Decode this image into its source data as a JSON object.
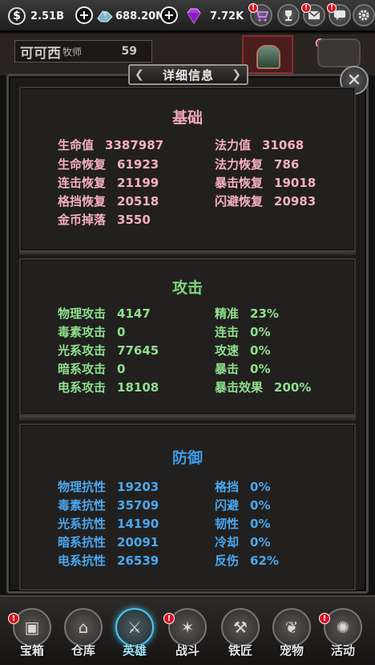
{
  "topbar": {
    "gold": "2.51B",
    "crystal": "688.20M",
    "gem": "7.72K",
    "icons": [
      "shop-cart-icon",
      "trophy-icon",
      "mail-icon",
      "chat-icon",
      "settings-icon"
    ]
  },
  "hero": {
    "name": "可可西",
    "class": "牧师",
    "level": "59"
  },
  "dialog": {
    "title": "详细信息",
    "sections": {
      "basic": {
        "title": "基础",
        "left": [
          {
            "label": "生命值",
            "value": "3387987"
          },
          {
            "label": "生命恢复",
            "value": "61923"
          },
          {
            "label": "连击恢复",
            "value": "21199"
          },
          {
            "label": "格挡恢复",
            "value": "20518"
          },
          {
            "label": "金币掉落",
            "value": "3550"
          }
        ],
        "right": [
          {
            "label": "法力值",
            "value": "31068"
          },
          {
            "label": "法力恢复",
            "value": "786"
          },
          {
            "label": "暴击恢复",
            "value": "19018"
          },
          {
            "label": "闪避恢复",
            "value": "20983"
          }
        ]
      },
      "attack": {
        "title": "攻击",
        "left": [
          {
            "label": "物理攻击",
            "value": "4147"
          },
          {
            "label": "毒素攻击",
            "value": "0"
          },
          {
            "label": "光系攻击",
            "value": "77645"
          },
          {
            "label": "暗系攻击",
            "value": "0"
          },
          {
            "label": "电系攻击",
            "value": "18108"
          }
        ],
        "right": [
          {
            "label": "精准",
            "value": "23%"
          },
          {
            "label": "连击",
            "value": "0%"
          },
          {
            "label": "攻速",
            "value": "0%"
          },
          {
            "label": "暴击",
            "value": "0%"
          },
          {
            "label": "暴击效果",
            "value": "200%"
          }
        ]
      },
      "defense": {
        "title": "防御",
        "left": [
          {
            "label": "物理抗性",
            "value": "19203"
          },
          {
            "label": "毒素抗性",
            "value": "35709"
          },
          {
            "label": "光系抗性",
            "value": "14190"
          },
          {
            "label": "暗系抗性",
            "value": "20091"
          },
          {
            "label": "电系抗性",
            "value": "26539"
          }
        ],
        "right": [
          {
            "label": "格挡",
            "value": "0%"
          },
          {
            "label": "闪避",
            "value": "0%"
          },
          {
            "label": "韧性",
            "value": "0%"
          },
          {
            "label": "冷却",
            "value": "0%"
          },
          {
            "label": "反伤",
            "value": "62%"
          }
        ]
      }
    }
  },
  "nav": [
    {
      "label": "宝箱",
      "icon": "chest-icon",
      "badge": "!"
    },
    {
      "label": "仓库",
      "icon": "warehouse-icon",
      "badge": ""
    },
    {
      "label": "英雄",
      "icon": "hero-icon",
      "badge": "",
      "active": true
    },
    {
      "label": "战斗",
      "icon": "battle-icon",
      "badge": "!"
    },
    {
      "label": "铁匠",
      "icon": "blacksmith-icon",
      "badge": ""
    },
    {
      "label": "宠物",
      "icon": "pet-icon",
      "badge": ""
    },
    {
      "label": "活动",
      "icon": "event-icon",
      "badge": "!"
    }
  ],
  "badge_mark": "!",
  "colors": {
    "basic": "#f6b0c4",
    "attack": "#8fe08e",
    "defense": "#4aa8f0",
    "active_nav": "#4fc7e6",
    "alert": "#d8101c"
  }
}
